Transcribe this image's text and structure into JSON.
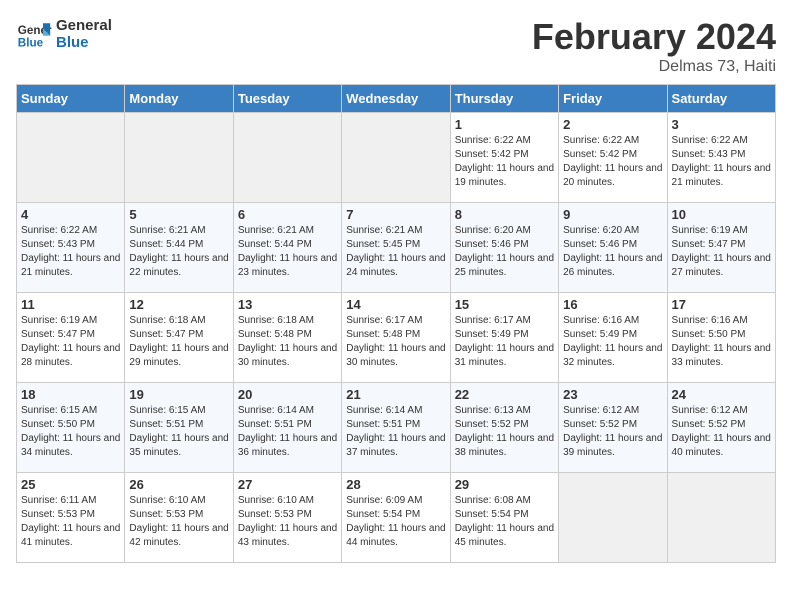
{
  "header": {
    "logo_general": "General",
    "logo_blue": "Blue",
    "month_title": "February 2024",
    "location": "Delmas 73, Haiti"
  },
  "weekdays": [
    "Sunday",
    "Monday",
    "Tuesday",
    "Wednesday",
    "Thursday",
    "Friday",
    "Saturday"
  ],
  "weeks": [
    [
      {
        "day": null
      },
      {
        "day": null
      },
      {
        "day": null
      },
      {
        "day": null
      },
      {
        "day": "1",
        "sunrise": "6:22 AM",
        "sunset": "5:42 PM",
        "daylight": "11 hours and 19 minutes."
      },
      {
        "day": "2",
        "sunrise": "6:22 AM",
        "sunset": "5:42 PM",
        "daylight": "11 hours and 20 minutes."
      },
      {
        "day": "3",
        "sunrise": "6:22 AM",
        "sunset": "5:43 PM",
        "daylight": "11 hours and 21 minutes."
      }
    ],
    [
      {
        "day": "4",
        "sunrise": "6:22 AM",
        "sunset": "5:43 PM",
        "daylight": "11 hours and 21 minutes."
      },
      {
        "day": "5",
        "sunrise": "6:21 AM",
        "sunset": "5:44 PM",
        "daylight": "11 hours and 22 minutes."
      },
      {
        "day": "6",
        "sunrise": "6:21 AM",
        "sunset": "5:44 PM",
        "daylight": "11 hours and 23 minutes."
      },
      {
        "day": "7",
        "sunrise": "6:21 AM",
        "sunset": "5:45 PM",
        "daylight": "11 hours and 24 minutes."
      },
      {
        "day": "8",
        "sunrise": "6:20 AM",
        "sunset": "5:46 PM",
        "daylight": "11 hours and 25 minutes."
      },
      {
        "day": "9",
        "sunrise": "6:20 AM",
        "sunset": "5:46 PM",
        "daylight": "11 hours and 26 minutes."
      },
      {
        "day": "10",
        "sunrise": "6:19 AM",
        "sunset": "5:47 PM",
        "daylight": "11 hours and 27 minutes."
      }
    ],
    [
      {
        "day": "11",
        "sunrise": "6:19 AM",
        "sunset": "5:47 PM",
        "daylight": "11 hours and 28 minutes."
      },
      {
        "day": "12",
        "sunrise": "6:18 AM",
        "sunset": "5:47 PM",
        "daylight": "11 hours and 29 minutes."
      },
      {
        "day": "13",
        "sunrise": "6:18 AM",
        "sunset": "5:48 PM",
        "daylight": "11 hours and 30 minutes."
      },
      {
        "day": "14",
        "sunrise": "6:17 AM",
        "sunset": "5:48 PM",
        "daylight": "11 hours and 30 minutes."
      },
      {
        "day": "15",
        "sunrise": "6:17 AM",
        "sunset": "5:49 PM",
        "daylight": "11 hours and 31 minutes."
      },
      {
        "day": "16",
        "sunrise": "6:16 AM",
        "sunset": "5:49 PM",
        "daylight": "11 hours and 32 minutes."
      },
      {
        "day": "17",
        "sunrise": "6:16 AM",
        "sunset": "5:50 PM",
        "daylight": "11 hours and 33 minutes."
      }
    ],
    [
      {
        "day": "18",
        "sunrise": "6:15 AM",
        "sunset": "5:50 PM",
        "daylight": "11 hours and 34 minutes."
      },
      {
        "day": "19",
        "sunrise": "6:15 AM",
        "sunset": "5:51 PM",
        "daylight": "11 hours and 35 minutes."
      },
      {
        "day": "20",
        "sunrise": "6:14 AM",
        "sunset": "5:51 PM",
        "daylight": "11 hours and 36 minutes."
      },
      {
        "day": "21",
        "sunrise": "6:14 AM",
        "sunset": "5:51 PM",
        "daylight": "11 hours and 37 minutes."
      },
      {
        "day": "22",
        "sunrise": "6:13 AM",
        "sunset": "5:52 PM",
        "daylight": "11 hours and 38 minutes."
      },
      {
        "day": "23",
        "sunrise": "6:12 AM",
        "sunset": "5:52 PM",
        "daylight": "11 hours and 39 minutes."
      },
      {
        "day": "24",
        "sunrise": "6:12 AM",
        "sunset": "5:52 PM",
        "daylight": "11 hours and 40 minutes."
      }
    ],
    [
      {
        "day": "25",
        "sunrise": "6:11 AM",
        "sunset": "5:53 PM",
        "daylight": "11 hours and 41 minutes."
      },
      {
        "day": "26",
        "sunrise": "6:10 AM",
        "sunset": "5:53 PM",
        "daylight": "11 hours and 42 minutes."
      },
      {
        "day": "27",
        "sunrise": "6:10 AM",
        "sunset": "5:53 PM",
        "daylight": "11 hours and 43 minutes."
      },
      {
        "day": "28",
        "sunrise": "6:09 AM",
        "sunset": "5:54 PM",
        "daylight": "11 hours and 44 minutes."
      },
      {
        "day": "29",
        "sunrise": "6:08 AM",
        "sunset": "5:54 PM",
        "daylight": "11 hours and 45 minutes."
      },
      {
        "day": null
      },
      {
        "day": null
      }
    ]
  ]
}
